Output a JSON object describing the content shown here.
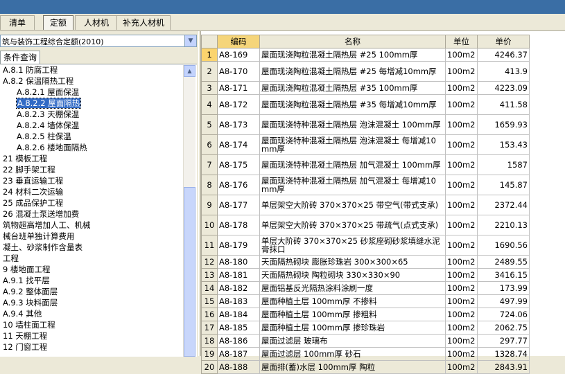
{
  "tabs": [
    {
      "label": "清单",
      "active": false
    },
    {
      "label": "定额",
      "active": true
    },
    {
      "label": "人材机",
      "active": false
    },
    {
      "label": "补充人材机",
      "active": false
    }
  ],
  "quota_selector": {
    "value": "筑与装饰工程综合定额(2010)"
  },
  "query_tab": {
    "label": "条件查询"
  },
  "tree": [
    {
      "label": "A.8.1 防腐工程",
      "indent": 0,
      "selected": false
    },
    {
      "label": "A.8.2 保温隔热工程",
      "indent": 0,
      "selected": false
    },
    {
      "label": "A.8.2.1 屋面保温",
      "indent": 1,
      "selected": false
    },
    {
      "label": "A.8.2.2 屋面隔热",
      "indent": 1,
      "selected": true
    },
    {
      "label": "A.8.2.3 天棚保温",
      "indent": 1,
      "selected": false
    },
    {
      "label": "A.8.2.4 墙体保温",
      "indent": 1,
      "selected": false
    },
    {
      "label": "A.8.2.5 柱保温",
      "indent": 1,
      "selected": false
    },
    {
      "label": "A.8.2.6 楼地面隔热",
      "indent": 1,
      "selected": false
    },
    {
      "label": "21 模板工程",
      "indent": 0,
      "selected": false
    },
    {
      "label": "22 脚手架工程",
      "indent": 0,
      "selected": false
    },
    {
      "label": "23 垂直运输工程",
      "indent": 0,
      "selected": false
    },
    {
      "label": "24 材料二次运输",
      "indent": 0,
      "selected": false
    },
    {
      "label": "25 成品保护工程",
      "indent": 0,
      "selected": false
    },
    {
      "label": "26 混凝土泵送增加费",
      "indent": 0,
      "selected": false
    },
    {
      "label": "筑物超高增加人工、机械",
      "indent": 0,
      "selected": false
    },
    {
      "label": "械台班单独计算费用",
      "indent": 0,
      "selected": false
    },
    {
      "label": "凝土、砂浆制作含量表",
      "indent": 0,
      "selected": false
    },
    {
      "label": "工程",
      "indent": 0,
      "selected": false
    },
    {
      "label": "9 楼地面工程",
      "indent": 0,
      "selected": false
    },
    {
      "label": "A.9.1 找平层",
      "indent": 0,
      "selected": false
    },
    {
      "label": "A.9.2 整体面层",
      "indent": 0,
      "selected": false
    },
    {
      "label": "A.9.3 块料面层",
      "indent": 0,
      "selected": false
    },
    {
      "label": "A.9.4 其他",
      "indent": 0,
      "selected": false
    },
    {
      "label": "10 墙柱面工程",
      "indent": 0,
      "selected": false
    },
    {
      "label": "11 天棚工程",
      "indent": 0,
      "selected": false
    },
    {
      "label": "12 门窗工程",
      "indent": 0,
      "selected": false
    }
  ],
  "table": {
    "headers": {
      "code": "编码",
      "name": "名称",
      "unit": "单位",
      "price": "单价"
    },
    "rows": [
      {
        "n": "1",
        "code": "A8-169",
        "name": "屋面现浇陶粒混凝土隔热层 #25 100mm厚",
        "unit": "100m2",
        "price": "4246.37"
      },
      {
        "n": "2",
        "code": "A8-170",
        "name": "屋面现浇陶粒混凝土隔热层 #25 每增减10mm厚",
        "unit": "100m2",
        "price": "413.9"
      },
      {
        "n": "3",
        "code": "A8-171",
        "name": "屋面现浇陶粒混凝土隔热层 #35 100mm厚",
        "unit": "100m2",
        "price": "4223.09"
      },
      {
        "n": "4",
        "code": "A8-172",
        "name": "屋面现浇陶粒混凝土隔热层 #35 每增减10mm厚",
        "unit": "100m2",
        "price": "411.58"
      },
      {
        "n": "5",
        "code": "A8-173",
        "name": "屋面现浇特种混凝土隔热层 泡沫混凝土 100mm厚",
        "unit": "100m2",
        "price": "1659.93"
      },
      {
        "n": "6",
        "code": "A8-174",
        "name": "屋面现浇特种混凝土隔热层 泡沫混凝土 每增减10mm厚",
        "unit": "100m2",
        "price": "153.43"
      },
      {
        "n": "7",
        "code": "A8-175",
        "name": "屋面现浇特种混凝土隔热层 加气混凝土 100mm厚",
        "unit": "100m2",
        "price": "1587"
      },
      {
        "n": "8",
        "code": "A8-176",
        "name": "屋面现浇特种混凝土隔热层 加气混凝土 每增减10mm厚",
        "unit": "100m2",
        "price": "145.87"
      },
      {
        "n": "9",
        "code": "A8-177",
        "name": "单层架空大阶砖 370×370×25 带空气(带式支承)",
        "unit": "100m2",
        "price": "2372.44"
      },
      {
        "n": "10",
        "code": "A8-178",
        "name": "单层架空大阶砖 370×370×25 带疏气(点式支承)",
        "unit": "100m2",
        "price": "2210.13"
      },
      {
        "n": "11",
        "code": "A8-179",
        "name": "单层大阶砖 370×370×25 砂浆座砌砂浆填缝水泥膏抹口",
        "unit": "100m2",
        "price": "1690.56"
      },
      {
        "n": "12",
        "code": "A8-180",
        "name": "天面隔热砌块 膨胀珍珠岩 300×300×65",
        "unit": "100m2",
        "price": "2489.55"
      },
      {
        "n": "13",
        "code": "A8-181",
        "name": "天面隔热砌块 陶粒砌块 330×330×90",
        "unit": "100m2",
        "price": "3416.15"
      },
      {
        "n": "14",
        "code": "A8-182",
        "name": "屋面铝基反光隔热涂料涂刷一度",
        "unit": "100m2",
        "price": "173.99"
      },
      {
        "n": "15",
        "code": "A8-183",
        "name": "屋面种植土层 100mm厚 不掺料",
        "unit": "100m2",
        "price": "497.99"
      },
      {
        "n": "16",
        "code": "A8-184",
        "name": "屋面种植土层 100mm厚 掺粗料",
        "unit": "100m2",
        "price": "724.06"
      },
      {
        "n": "17",
        "code": "A8-185",
        "name": "屋面种植土层 100mm厚 掺珍珠岩",
        "unit": "100m2",
        "price": "2062.75"
      },
      {
        "n": "18",
        "code": "A8-186",
        "name": "屋面过滤层 玻璃布",
        "unit": "100m2",
        "price": "297.77"
      },
      {
        "n": "19",
        "code": "A8-187",
        "name": "屋面过滤层 100mm厚 砂石",
        "unit": "100m2",
        "price": "1328.74"
      },
      {
        "n": "20",
        "code": "A8-188",
        "name": "屋面排(蓄)水层 100mm厚 陶粒",
        "unit": "100m2",
        "price": "2843.91"
      }
    ]
  },
  "colors": {
    "selection": "#316ac5",
    "header_highlight": "#f5d57a",
    "title_bar": "#3a6ea5"
  }
}
